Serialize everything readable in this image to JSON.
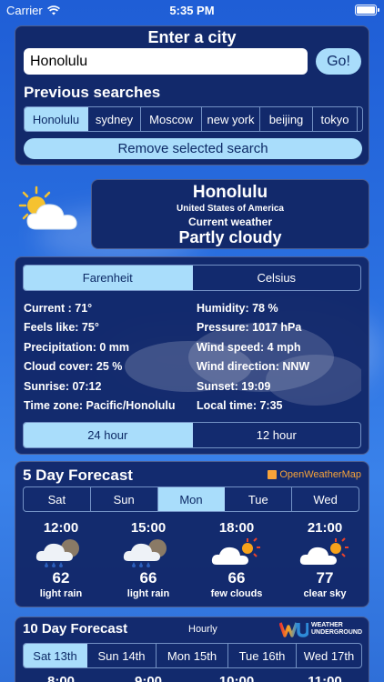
{
  "status": {
    "carrier": "Carrier",
    "time": "5:35 PM"
  },
  "search": {
    "title": "Enter a city",
    "value": "Honolulu",
    "go_label": "Go!",
    "previous_title": "Previous searches",
    "previous": [
      "Honolulu",
      "sydney",
      "Moscow",
      "new york",
      "beijing",
      "tokyo"
    ],
    "selected_index": 0,
    "remove_label": "Remove selected search"
  },
  "current": {
    "icon": "partly-cloudy-icon",
    "city": "Honolulu",
    "country": "United States of America",
    "heading": "Current weather",
    "condition": "Partly cloudy"
  },
  "units": {
    "options": [
      "Farenheit",
      "Celsius"
    ],
    "selected": 0
  },
  "details": {
    "current": "Current : 71°",
    "feels": "Feels like: 75°",
    "precip": "Precipitation: 0 mm",
    "cloud": "Cloud cover: 25 %",
    "sunrise": "Sunrise: 07:12",
    "timezone": "Time zone: Pacific/Honolulu",
    "humidity": "Humidity: 78 %",
    "pressure": "Pressure: 1017 hPa",
    "wind_speed": "Wind speed: 4 mph",
    "wind_dir": "Wind direction: NNW",
    "sunset": "Sunset: 19:09",
    "local_time": "Local time: 7:35"
  },
  "hour_format": {
    "options": [
      "24 hour",
      "12 hour"
    ],
    "selected": 0
  },
  "forecast5": {
    "title": "5 Day Forecast",
    "provider": "OpenWeatherMap",
    "days": [
      "Sat",
      "Sun",
      "Mon",
      "Tue",
      "Wed"
    ],
    "selected": 2,
    "hours": [
      {
        "time": "12:00",
        "temp": "62",
        "desc": "light rain",
        "icon": "rain-cloud-icon"
      },
      {
        "time": "15:00",
        "temp": "66",
        "desc": "light rain",
        "icon": "rain-cloud-icon"
      },
      {
        "time": "18:00",
        "temp": "66",
        "desc": "few clouds",
        "icon": "sun-cloud-icon"
      },
      {
        "time": "21:00",
        "temp": "77",
        "desc": "clear sky",
        "icon": "sun-cloud-icon"
      }
    ]
  },
  "forecast10": {
    "title": "10 Day Forecast",
    "hourly_label": "Hourly",
    "provider_line1": "WEATHER",
    "provider_line2": "UNDERGROUND",
    "days": [
      "Sat 13th",
      "Sun 14th",
      "Mon 15th",
      "Tue 16th",
      "Wed 17th"
    ],
    "selected": 0,
    "times": [
      "8:00",
      "9:00",
      "10:00",
      "11:00"
    ]
  },
  "colors": {
    "accent": "#a9ddfb",
    "panel": "#12296b",
    "background": "#2a6fe0"
  }
}
